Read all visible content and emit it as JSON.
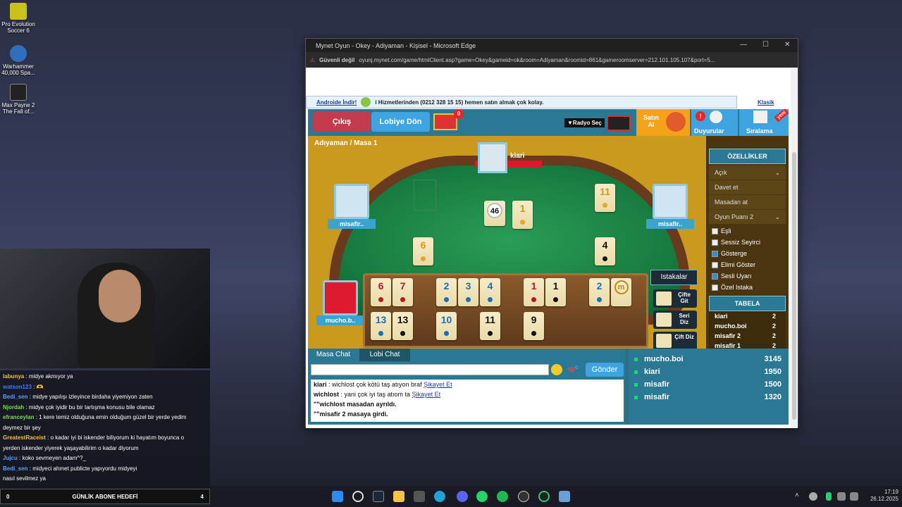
{
  "desktop": {
    "icons": [
      {
        "label": "Pro Evolution Soccer 6"
      },
      {
        "label": "Warhammer 40,000 Spa..."
      },
      {
        "label": "Max Payne 2 The Fall of..."
      }
    ]
  },
  "stream_chat": {
    "messages": [
      {
        "user": "labunya",
        "text": ": midye akmıyor ya",
        "color": "#f0c040"
      },
      {
        "user": "watson123",
        "text": ": 🫶",
        "color": "#3b7cff"
      },
      {
        "user": "Bedi_sen",
        "text": ": midye yapılışı izleyince birdaha yiyemiyon zaten",
        "color": "#5aa0ff"
      },
      {
        "user": "Njordah",
        "text": ": midye çok iyidir bu bir tartışma konusu bile olamaz",
        "color": "#7ed957"
      },
      {
        "user": "efranceylan",
        "text": ": 1 kere temiz olduğuna emin olduğum güzel bir yerde yedim",
        "color": "#7ed957"
      },
      {
        "user": "",
        "text": "deymez bir şey",
        "color": "#ffffff"
      },
      {
        "user": "GreatestRaceist",
        "text": ": o kadar iyi bi iskender biliyorum ki hayatım boyunca o",
        "color": "#f0c040"
      },
      {
        "user": "",
        "text": "yerden iskender yiyerek yaşayabilirim o kadar diyorum",
        "color": "#ffffff"
      },
      {
        "user": "Jujcu",
        "text": ": koko sevmeyen adam^?_",
        "color": "#5aa0ff"
      },
      {
        "user": "Bedi_sen",
        "text": ": midyeci ahmet publicte yapıyordu midyeyi",
        "color": "#5aa0ff"
      },
      {
        "user": "",
        "text": "nasıl sevilmez ya",
        "color": "#ffffff"
      }
    ],
    "goal_left": "0",
    "goal_label": "GÜNLİK ABONE HEDEFİ",
    "goal_right": "4"
  },
  "browser": {
    "title": "Mynet Oyun - Okey - Adiyaman - Kişisel - Microsoft Edge",
    "security": "Güvenli değil",
    "url": "oyunj.mynet.com/game/htmlClient.asp?game=Okey&gameid=ok&room=Adiyaman&roomid=861&gameroomserver=212.101.105.107&port=5..."
  },
  "banner": {
    "android": "Androide İndir!",
    "ad": "i Hizmetlerinden (0212 328 15 15) hemen satın almak çok kolay.",
    "classic": "Klasik"
  },
  "topbar": {
    "exit": "Çıkış",
    "lobby": "Lobiye Dön",
    "gift_badge": "0",
    "radio": "▼Radyo Seç",
    "buy": "Satın Al",
    "notices": "Duyurular",
    "ranking": "Sıralama",
    "new": "yeni"
  },
  "table": {
    "title": "Adıyaman / Masa 1",
    "players": {
      "top": "kiari",
      "left": "misafir..",
      "right": "misafir..",
      "self": "mucho.b.."
    },
    "center_count": "46",
    "indicator_tile": {
      "n": "1",
      "color": "yellow"
    },
    "discard_top_right": {
      "n": "11",
      "color": "yellow"
    },
    "discard_left": {
      "n": "6",
      "color": "yellow"
    },
    "discard_right": {
      "n": "4",
      "color": "black"
    },
    "rack_row1": [
      {
        "n": "6",
        "color": "red"
      },
      {
        "n": "7",
        "color": "red"
      },
      {
        "n": "",
        "color": "gap"
      },
      {
        "n": "2",
        "color": "blue"
      },
      {
        "n": "3",
        "color": "blue"
      },
      {
        "n": "4",
        "color": "blue"
      },
      {
        "n": "",
        "color": "gap"
      },
      {
        "n": "1",
        "color": "red"
      },
      {
        "n": "1",
        "color": "black"
      },
      {
        "n": "",
        "color": "gap"
      },
      {
        "n": "2",
        "color": "blue"
      },
      {
        "n": "m",
        "color": "joker"
      }
    ],
    "rack_row2": [
      {
        "n": "13",
        "color": "blue"
      },
      {
        "n": "13",
        "color": "black"
      },
      {
        "n": "",
        "color": "gap"
      },
      {
        "n": "10",
        "color": "blue"
      },
      {
        "n": "",
        "color": "gap"
      },
      {
        "n": "11",
        "color": "black"
      },
      {
        "n": "",
        "color": "gap"
      },
      {
        "n": "9",
        "color": "black"
      }
    ],
    "istakalar": "Istakalar",
    "cifte_git": "Çifte Git",
    "seri_diz": "Seri Diz",
    "cift_diz": "Çift Diz"
  },
  "side": {
    "features_title": "ÖZELLİKLER",
    "open": "Açık",
    "invite": "Davet et",
    "kick": "Masadan at",
    "game_points_label": "Oyun Puanı",
    "game_points": "2",
    "options": [
      {
        "label": "Eşli",
        "checked": false
      },
      {
        "label": "Sessiz Seyirci",
        "checked": false
      },
      {
        "label": "Gösterge",
        "checked": true
      },
      {
        "label": "Elimi Göster",
        "checked": false
      },
      {
        "label": "Sesli Uyarı",
        "checked": true
      },
      {
        "label": "Özel Istaka",
        "checked": false
      }
    ],
    "board_title": "TABELA",
    "board": [
      {
        "name": "kiari",
        "score": "2"
      },
      {
        "name": "mucho.boi",
        "score": "2"
      },
      {
        "name": "misafir 2",
        "score": "2"
      },
      {
        "name": "misafir 1",
        "score": "2"
      }
    ]
  },
  "chat": {
    "tab_table": "Masa Chat",
    "tab_lobby": "Lobi Chat",
    "send": "Gönder",
    "report": "Şikayet Et",
    "lines": [
      {
        "pre": "kiari",
        "text": " : wichlost çok kötü taş atıyon braf ",
        "report": true
      },
      {
        "pre": "wichlost",
        "text": " : yani çok iyi taş atıom ta ",
        "report": true
      },
      {
        "pre": "",
        "text": "\"\"wichlost masadan ayrıldı.",
        "report": false
      },
      {
        "pre": "",
        "text": "\"\"misafir 2 masaya girdi.",
        "report": false
      }
    ]
  },
  "scores": [
    {
      "name": "mucho.boi",
      "score": "3145"
    },
    {
      "name": "kiari",
      "score": "1950"
    },
    {
      "name": "misafir",
      "score": "1500"
    },
    {
      "name": "misafir",
      "score": "1320"
    }
  ],
  "taskbar": {
    "time": "17:19",
    "date": "26.12.2025"
  }
}
